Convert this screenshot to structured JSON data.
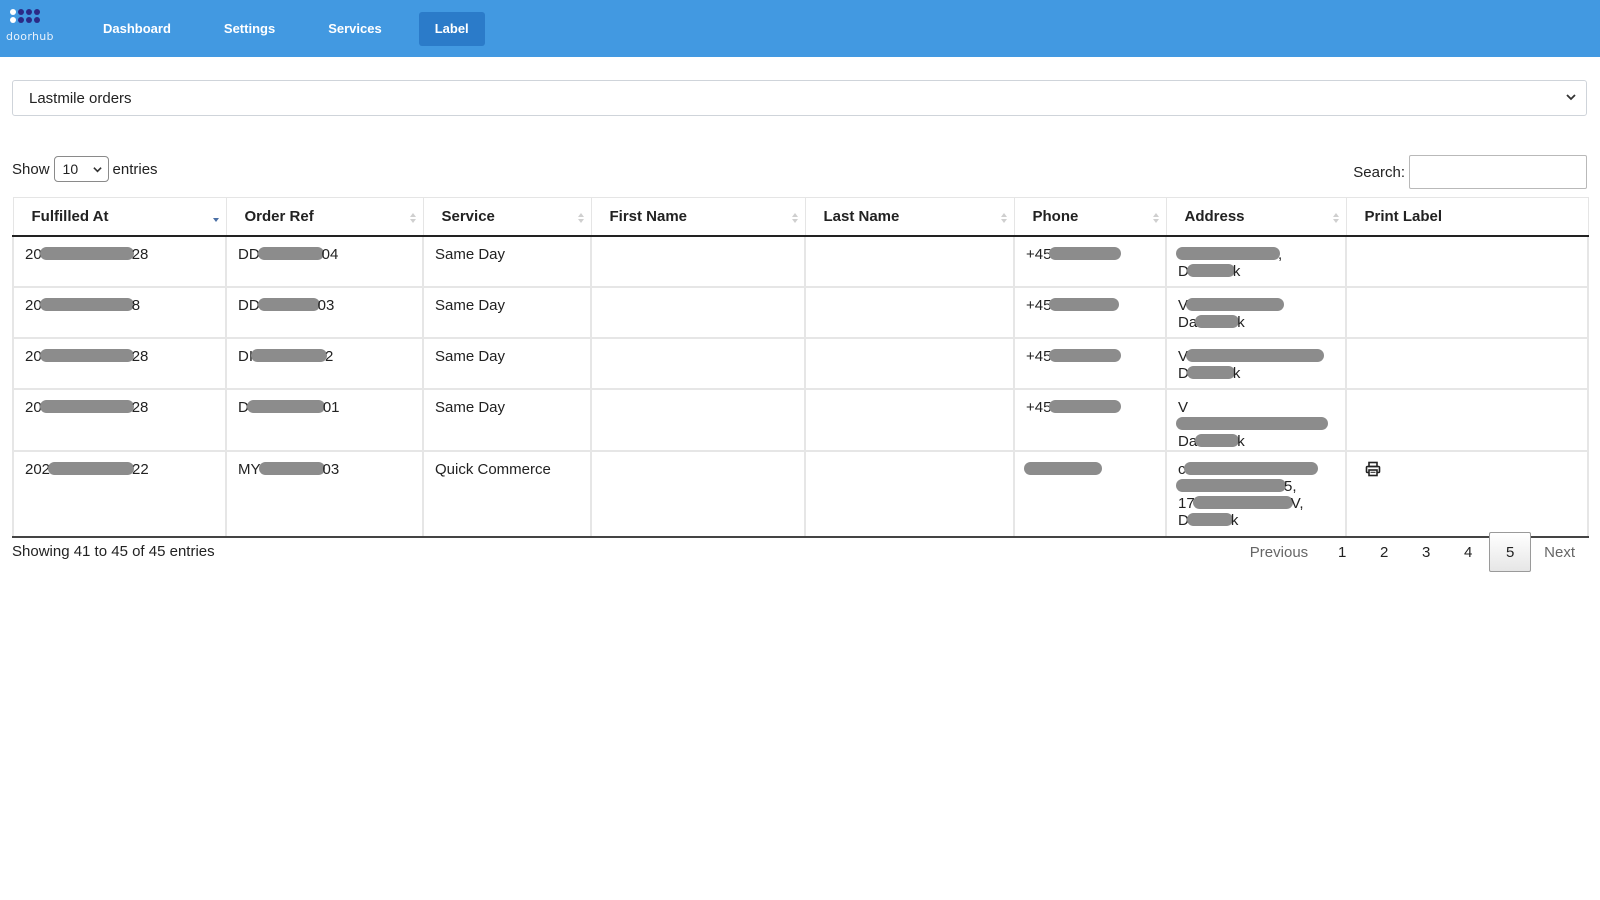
{
  "navbar": {
    "brand": "doorhub",
    "items": [
      {
        "label": "Dashboard",
        "active": false
      },
      {
        "label": "Settings",
        "active": false
      },
      {
        "label": "Services",
        "active": false
      },
      {
        "label": "Label",
        "active": true
      }
    ]
  },
  "table_select": {
    "selected": "Lastmile orders"
  },
  "controls": {
    "show_label": "Show",
    "length_value": "10",
    "entries_label": "entries",
    "search_label": "Search:"
  },
  "table": {
    "columns": [
      "Fulfilled At",
      "Order Ref",
      "Service",
      "First Name",
      "Last Name",
      "Phone",
      "Address",
      "Print Label"
    ],
    "rows": [
      {
        "fulfilled_at": [
          "20",
          "28"
        ],
        "order_ref": [
          "DD",
          "04"
        ],
        "service": "Same Day",
        "first_name": "",
        "last_name": "",
        "phone": [
          "+45",
          ""
        ],
        "address": [
          [
            "",
            ","
          ],
          [
            "D",
            "k"
          ]
        ],
        "print_label": false
      },
      {
        "fulfilled_at": [
          "20",
          "8"
        ],
        "order_ref": [
          "DD",
          "03"
        ],
        "service": "Same Day",
        "first_name": "",
        "last_name": "",
        "phone": [
          "+45",
          ""
        ],
        "address": [
          [
            "V",
            ""
          ],
          [
            "Da",
            "k"
          ]
        ],
        "print_label": false
      },
      {
        "fulfilled_at": [
          "20",
          "28"
        ],
        "order_ref": [
          "DI",
          "2"
        ],
        "service": "Same Day",
        "first_name": "",
        "last_name": "",
        "phone": [
          "+45",
          ""
        ],
        "address": [
          [
            "V",
            ""
          ],
          [
            "D",
            "k"
          ]
        ],
        "print_label": false
      },
      {
        "fulfilled_at": [
          "20",
          "28"
        ],
        "order_ref": [
          "D",
          "01"
        ],
        "service": "Same Day",
        "first_name": "",
        "last_name": "",
        "phone": [
          "+45",
          ""
        ],
        "address": [
          [
            "V",
            ""
          ],
          [
            "Da",
            "k"
          ]
        ],
        "print_label": false
      },
      {
        "fulfilled_at": [
          "202",
          "22"
        ],
        "order_ref": [
          "MY",
          "03"
        ],
        "service": "Quick Commerce",
        "first_name": "",
        "last_name": "",
        "phone": [
          "",
          ""
        ],
        "address": [
          [
            "c",
            ""
          ],
          [
            "",
            "5,"
          ],
          [
            "17",
            "V,"
          ],
          [
            "D",
            "k"
          ]
        ],
        "print_label": true
      }
    ]
  },
  "info": "Showing 41 to 45 of 45 entries",
  "pagination": {
    "previous": "Previous",
    "pages": [
      "1",
      "2",
      "3",
      "4",
      "5"
    ],
    "current": "5",
    "next": "Next"
  },
  "colors": {
    "navbar": "#4299e1",
    "nav_active": "#2b7bc9",
    "redaction": "#8c8c8c"
  },
  "icons": {
    "sorted_desc": "sort-desc-icon",
    "sortable": "sort-both-icon",
    "print": "printer-icon",
    "dropdown": "chevron-down-icon"
  }
}
